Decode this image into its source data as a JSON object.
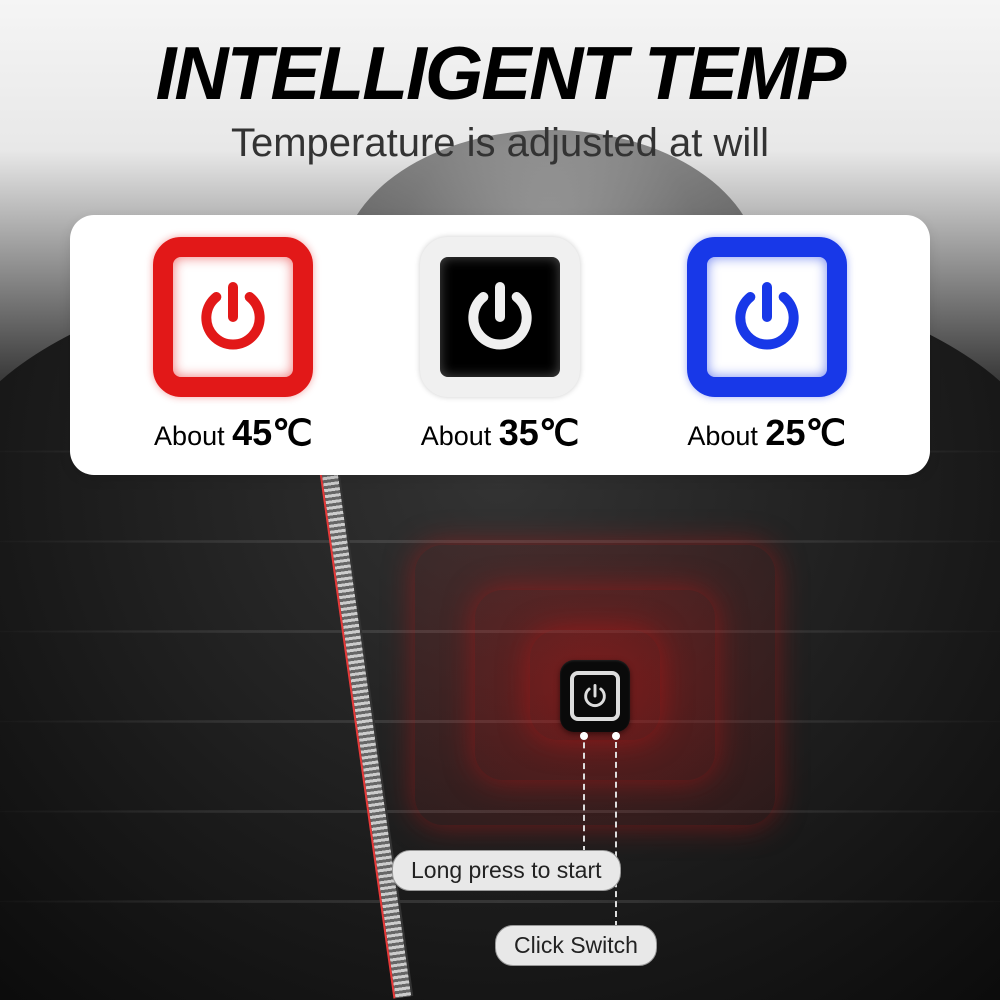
{
  "header": {
    "title": "INTELLIGENT TEMP",
    "subtitle": "Temperature is adjusted at will"
  },
  "temps": [
    {
      "prefix": "About ",
      "value": "45",
      "unit": "℃",
      "color": "red",
      "iconColor": "#e21818"
    },
    {
      "prefix": "About ",
      "value": "35",
      "unit": "℃",
      "color": "white",
      "iconColor": "#f0f0f0"
    },
    {
      "prefix": "About ",
      "value": "25",
      "unit": "℃",
      "color": "blue",
      "iconColor": "#1838e8"
    }
  ],
  "callouts": {
    "longpress": "Long press to start",
    "click": "Click Switch"
  }
}
